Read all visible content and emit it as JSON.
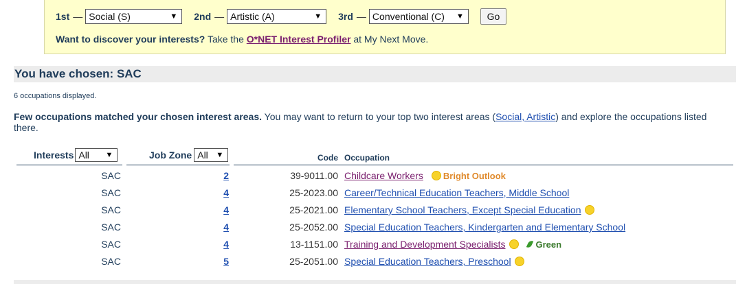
{
  "selector": {
    "first_label": "1st",
    "first_value": "Social (S)",
    "second_label": "2nd",
    "second_value": "Artistic (A)",
    "third_label": "3rd",
    "third_value": "Conventional (C)",
    "dash": "—",
    "go_label": "Go",
    "discover_bold": "Want to discover your interests?",
    "discover_text": " Take the ",
    "discover_link": "O*NET Interest Profiler",
    "discover_after": " at My Next Move."
  },
  "chosen": {
    "title": "You have chosen: SAC"
  },
  "count_text": "6 occupations displayed.",
  "notice": {
    "bold": "Few occupations matched your chosen interest areas.",
    "text": " You may want to return to your top two interest areas (",
    "link": "Social, Artistic",
    "after": ") and explore the occupations listed there."
  },
  "table": {
    "headers": {
      "interests": "Interests",
      "interests_filter": "All",
      "job_zone": "Job Zone",
      "job_zone_filter": "All",
      "code": "Code",
      "occupation": "Occupation"
    },
    "rows": [
      {
        "interests": "SAC",
        "job_zone": "2",
        "code": "39-9011.00",
        "occupation": "Childcare Workers",
        "badge": "Bright Outlook"
      },
      {
        "interests": "SAC",
        "job_zone": "4",
        "code": "25-2023.00",
        "occupation": "Career/Technical Education Teachers, Middle School"
      },
      {
        "interests": "SAC",
        "job_zone": "4",
        "code": "25-2021.00",
        "occupation": "Elementary School Teachers, Except Special Education"
      },
      {
        "interests": "SAC",
        "job_zone": "4",
        "code": "25-2052.00",
        "occupation": "Special Education Teachers, Kindergarten and Elementary School"
      },
      {
        "interests": "SAC",
        "job_zone": "4",
        "code": "13-1151.00",
        "occupation": "Training and Development Specialists",
        "badge2": "Green"
      },
      {
        "interests": "SAC",
        "job_zone": "5",
        "code": "25-2051.00",
        "occupation": "Special Education Teachers, Preschool"
      }
    ]
  },
  "colors": {
    "header_bg": "#ffffcc",
    "accent_text": "#1f3c5a",
    "visited_link": "#7a1f6e",
    "link": "#1f4fb0",
    "bright_outlook": "#e08a2c",
    "green": "#3a7a2c"
  },
  "icons": {
    "bright_outlook": "sun-icon",
    "green": "leaf-icon"
  }
}
